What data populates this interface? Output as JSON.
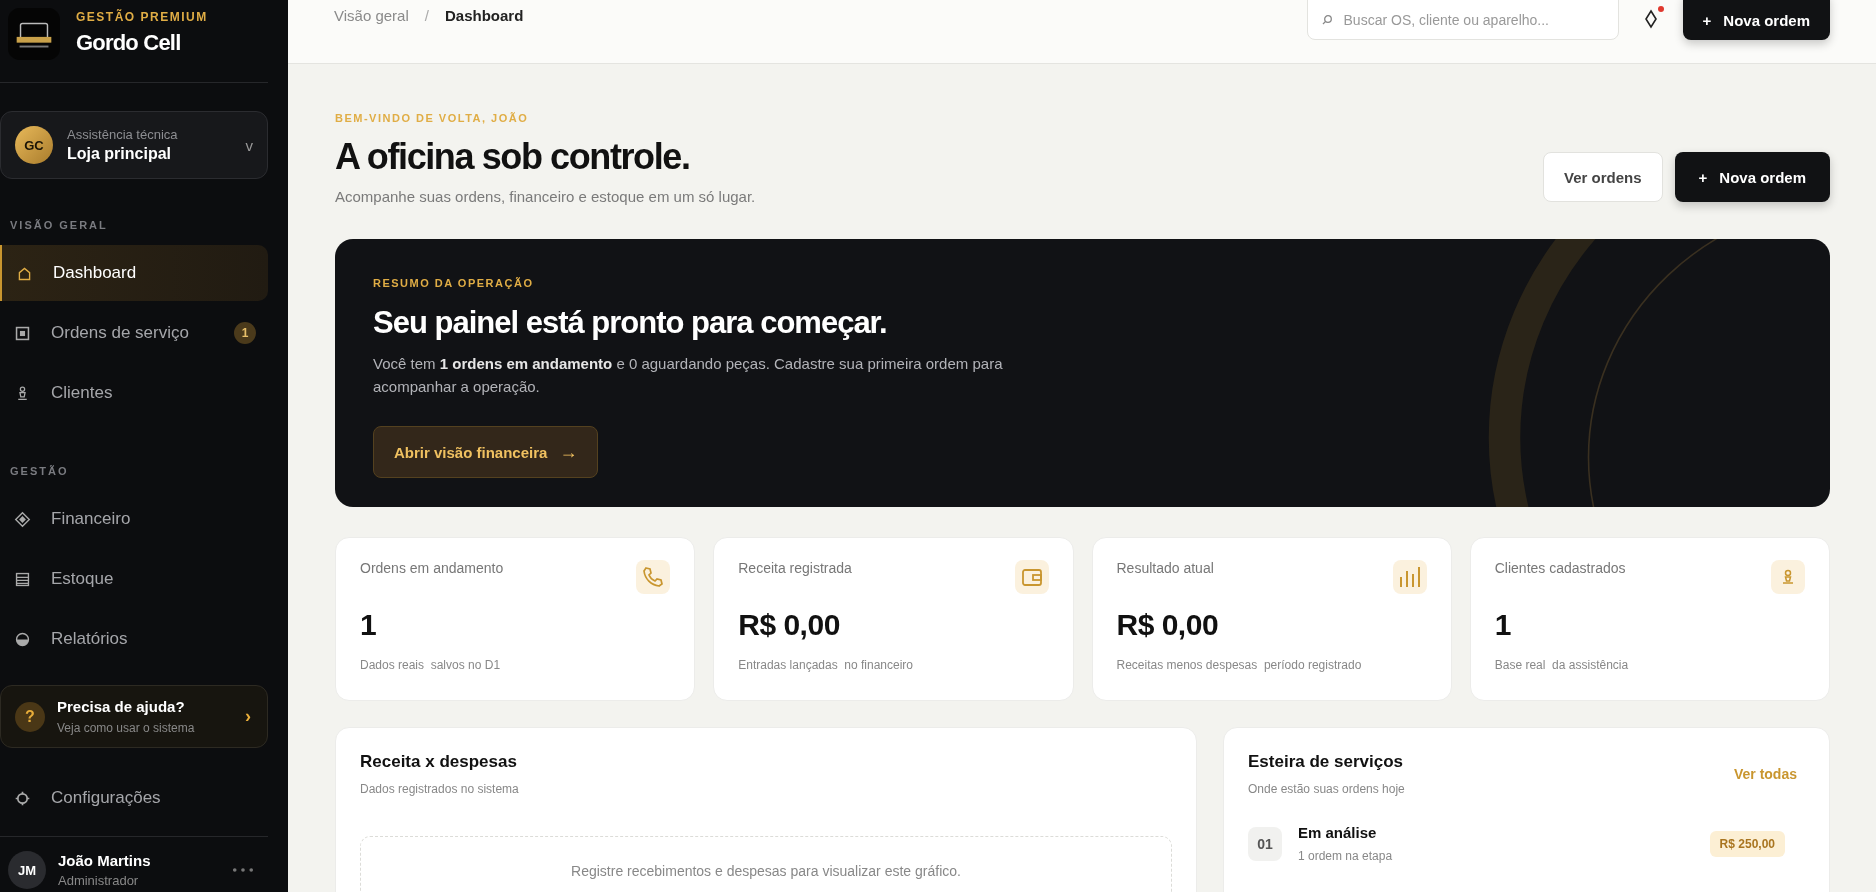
{
  "brand": {
    "tagline": "GESTÃO PREMIUM",
    "name": "Gordo Cell"
  },
  "store": {
    "initials": "GC",
    "caption": "Assistência técnica",
    "name": "Loja principal",
    "chevron": "v"
  },
  "nav_sections": [
    {
      "title": "VISÃO GERAL",
      "items": [
        {
          "label": "Dashboard",
          "kind": "home",
          "selected": true
        },
        {
          "label": "Ordens de serviço",
          "kind": "orders",
          "selected": false,
          "badge": "1"
        },
        {
          "label": "Clientes",
          "kind": "clients",
          "selected": false
        }
      ]
    },
    {
      "title": "GESTÃO",
      "items": [
        {
          "label": "Financeiro",
          "kind": "finance",
          "selected": false
        },
        {
          "label": "Estoque",
          "kind": "stock",
          "selected": false
        },
        {
          "label": "Relatórios",
          "kind": "reports",
          "selected": false
        }
      ]
    }
  ],
  "help": {
    "mark": "?",
    "title": "Precisa de ajuda?",
    "subtitle": "Veja como usar o sistema",
    "arrow": "›"
  },
  "settings": {
    "label": "Configurações",
    "selected": false
  },
  "user": {
    "initials": "JM",
    "name": "João Martins",
    "role": "Administrador"
  },
  "header": {
    "breadcrumb": [
      "Visão geral",
      "Dashboard"
    ],
    "separator": "/",
    "search": {
      "placeholder": "Buscar OS, cliente ou aparelho..."
    },
    "notifications": {
      "unread": true
    },
    "new_button": {
      "icon": "+",
      "label": "Nova ordem"
    }
  },
  "welcome": {
    "eyebrow": "BEM-VINDO DE VOLTA, JOÃO",
    "title": "A oficina sob controle.",
    "subtitle": "Acompanhe suas ordens, financeiro e estoque em um só lugar.",
    "secondary_button": "Ver ordens",
    "primary_button": {
      "icon": "+",
      "label": "Nova ordem"
    }
  },
  "summary": {
    "eyebrow": "RESUMO DA OPERAÇÃO",
    "title": "Seu painel está pronto para começar.",
    "text": "Você tem **1 ordens em andamento** e 0 aguardando peças. Cadastre sua primeira ordem para acompanhar a operação.",
    "button": {
      "label": "Abrir visão financeira",
      "arrow": "→"
    }
  },
  "stats": [
    {
      "label": "Ordens em andamento",
      "value": "1",
      "note": "Dados reais  salvos no D1",
      "kind": "orders"
    },
    {
      "label": "Receita registrada",
      "value": "R$ 0,00",
      "note": "Entradas lançadas  no financeiro",
      "kind": "revenue"
    },
    {
      "label": "Resultado atual",
      "value": "R$ 0,00",
      "note": "Receitas menos despesas  período registrado",
      "kind": "result"
    },
    {
      "label": "Clientes cadastrados",
      "value": "1",
      "note": "Base real  da assistência",
      "kind": "clients"
    }
  ],
  "revenue_panel": {
    "title": "Receita x despesas",
    "subtitle": "Dados registrados no sistema",
    "empty_message": "Registre recebimentos e despesas para visualizar este gráfico."
  },
  "pipeline": {
    "title": "Esteira de serviços",
    "subtitle": "Onde estão suas ordens hoje",
    "link": "Ver todas",
    "stages": [
      {
        "number": "01",
        "title": "Em análise",
        "subtitle": "1 ordem na etapa",
        "amount": "R$ 250,00"
      }
    ]
  }
}
